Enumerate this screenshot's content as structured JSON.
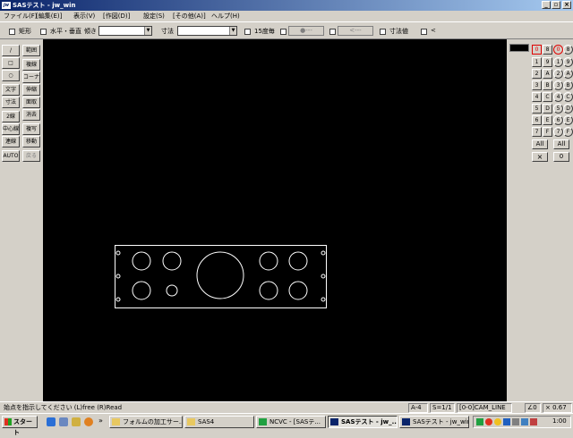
{
  "window": {
    "title": "SASテスト - jw_win",
    "app_icon": "jw"
  },
  "menu": [
    "ファイル(F)",
    "[編集(E)]",
    "表示(V)",
    "[作図(D)]",
    "設定(S)",
    "[その他(A)]",
    "ヘルプ(H)"
  ],
  "toolbar": {
    "rect_label": "矩形",
    "hv_label": "水平・垂直",
    "slope_label": "傾き",
    "dim_label": "寸法",
    "deg15_label": "15度毎",
    "dot_label": "●---",
    "arrow_label": "<---",
    "dimval_label": "寸法値",
    "lt_label": "<"
  },
  "left_tools": {
    "col1": [
      "/",
      "□",
      "○",
      "文字",
      "寸法",
      "2線",
      "中心線",
      "連線",
      "AUTO"
    ],
    "col2": [
      "範囲",
      "複線",
      "コーナー",
      "伸縮",
      "面取",
      "消去",
      "複写",
      "移動",
      "戻る"
    ]
  },
  "right_panel": {
    "row0": [
      "0",
      "8",
      "0",
      "8"
    ],
    "rows": [
      [
        "1",
        "9",
        "1",
        "9"
      ],
      [
        "2",
        "A",
        "2",
        "A"
      ],
      [
        "3",
        "B",
        "3",
        "B"
      ],
      [
        "4",
        "C",
        "4",
        "C"
      ],
      [
        "5",
        "D",
        "5",
        "D"
      ],
      [
        "6",
        "E",
        "6",
        "E"
      ],
      [
        "7",
        "F",
        "7",
        "F"
      ]
    ],
    "all_left": "All",
    "all_right": "All",
    "x_label": "×",
    "zero_label": "0"
  },
  "status": {
    "message": "始点を指示してください (L)free (R)Read",
    "paper": "A-4",
    "scale": "S=1/1",
    "layer": "[0-0]CAM_LINE",
    "angle": "∠0",
    "zoom": "× 0.67"
  },
  "taskbar": {
    "start": "スタート",
    "chevron": "»",
    "tasks": [
      "フォルムの加工サー...",
      "SAS4",
      "NCVC - [SASテ...",
      "SASテスト - jw_...",
      "SASテスト - jw_win"
    ],
    "clock": "1:00"
  },
  "colors": {
    "titlebar_start": "#0a246a",
    "titlebar_end": "#a6caf0",
    "canvas": "#000000",
    "drawing_line": "#ffffff",
    "active_layer_red": "#e00000"
  }
}
